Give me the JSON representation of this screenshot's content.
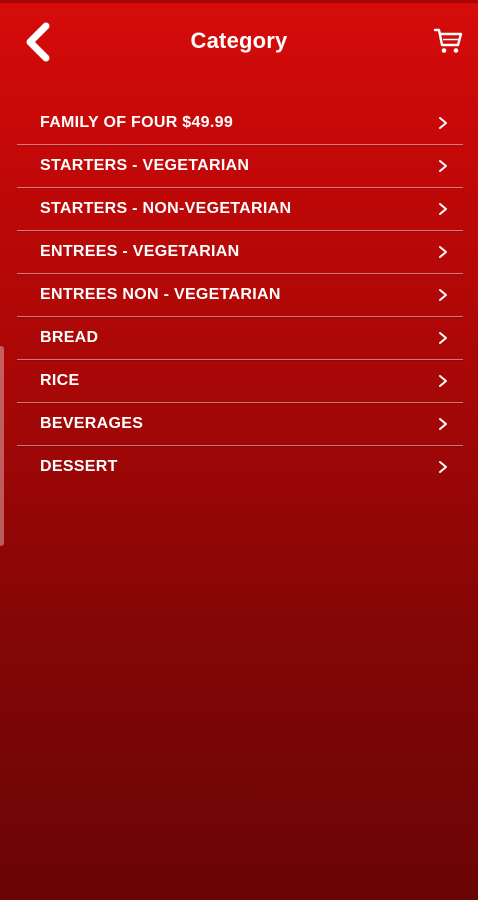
{
  "header": {
    "title": "Category",
    "back_icon": "chevron-left-icon",
    "cart_icon": "cart-icon"
  },
  "categories": [
    {
      "label": "FAMILY OF FOUR $49.99"
    },
    {
      "label": "STARTERS - VEGETARIAN"
    },
    {
      "label": "STARTERS - NON-VEGETARIAN"
    },
    {
      "label": "ENTREES - VEGETARIAN"
    },
    {
      "label": "ENTREES NON - VEGETARIAN"
    },
    {
      "label": "BREAD"
    },
    {
      "label": "RICE"
    },
    {
      "label": "BEVERAGES"
    },
    {
      "label": "DESSERT"
    }
  ],
  "colors": {
    "background_top": "#d60c0a",
    "background_bottom": "#6a0506",
    "text": "#ffffff"
  }
}
